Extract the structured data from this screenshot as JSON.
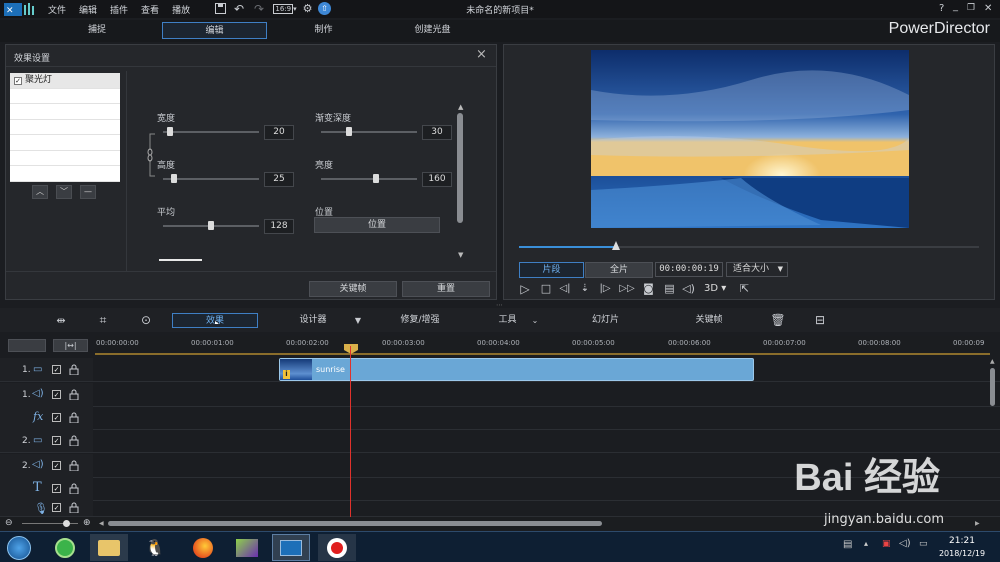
{
  "app": {
    "title": "未命名的新项目*",
    "brand": "PowerDirector",
    "menu": [
      "文件",
      "编辑",
      "插件",
      "查看",
      "播放"
    ],
    "window_controls": [
      "?",
      "_",
      "❐",
      "✕"
    ]
  },
  "modes": [
    "捕捉",
    "编辑",
    "制作",
    "创建光盘"
  ],
  "effect_panel": {
    "title": "效果设置",
    "list": [
      {
        "label": "聚光灯",
        "checked": true
      }
    ],
    "params": {
      "width": {
        "label": "宽度",
        "value": "20"
      },
      "height": {
        "label": "高度",
        "value": "25"
      },
      "average": {
        "label": "平均",
        "value": "128"
      },
      "gradient": {
        "label": "渐变深度",
        "value": "30"
      },
      "brightness": {
        "label": "亮度",
        "value": "160"
      },
      "position": {
        "label": "位置",
        "button": "位置"
      }
    },
    "keyframe_button": "关键帧",
    "reset_button": "重置"
  },
  "preview": {
    "clip_tab": "片段",
    "full_tab": "全片",
    "timecode": "00:00:00:19",
    "fit_label": "适合大小",
    "mode_3d": "3D",
    "progress": 0.21
  },
  "toolbar": {
    "effect": "效果",
    "designer": "设计器",
    "repair": "修复/增强",
    "tools": "工具",
    "slideshow": "幻灯片",
    "keyframe": "关键帧"
  },
  "ruler": [
    "00:00:00:00",
    "00:00:01:00",
    "00:00:02:00",
    "00:00:03:00",
    "00:00:04:00",
    "00:00:05:00",
    "00:00:06:00",
    "00:00:07:00",
    "00:00:08:00",
    "00:00:09"
  ],
  "tracks": [
    {
      "num": "1.",
      "type": "video"
    },
    {
      "num": "1.",
      "type": "audio"
    },
    {
      "num": "",
      "type": "fx"
    },
    {
      "num": "2.",
      "type": "video"
    },
    {
      "num": "2.",
      "type": "audio"
    },
    {
      "num": "",
      "type": "title"
    },
    {
      "num": "",
      "type": "voice"
    }
  ],
  "clip": {
    "label": "sunrise"
  },
  "clock": {
    "time": "21:21",
    "date": "2018/12/19"
  },
  "watermark": {
    "main": "Bai 经验",
    "url": "jingyan.baidu.com"
  },
  "colors": {
    "accent": "#3f7fc4",
    "clip": "#6aa7d6",
    "playhead": "#e0322c"
  }
}
